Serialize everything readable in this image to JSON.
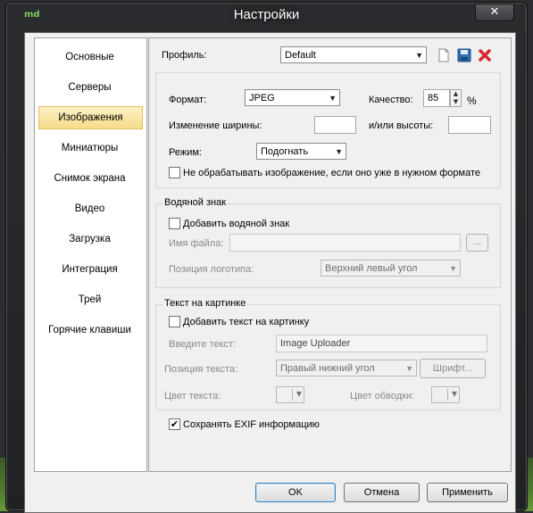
{
  "window": {
    "title": "Настройки",
    "app_icon_text": "md",
    "close_glyph": "✕"
  },
  "sidebar": {
    "items": [
      {
        "label": "Основные"
      },
      {
        "label": "Серверы"
      },
      {
        "label": "Изображения",
        "active": true
      },
      {
        "label": "Миниатюры"
      },
      {
        "label": "Снимок экрана"
      },
      {
        "label": "Видео"
      },
      {
        "label": "Загрузка"
      },
      {
        "label": "Интеграция"
      },
      {
        "label": "Трей"
      },
      {
        "label": "Горячие клавиши"
      }
    ]
  },
  "profile": {
    "label": "Профиль:",
    "value": "Default",
    "icons": [
      "new-file-icon",
      "save-icon",
      "delete-icon"
    ]
  },
  "image": {
    "format_label": "Формат:",
    "format_value": "JPEG",
    "quality_label": "Качество:",
    "quality_value": "85",
    "quality_unit": "%",
    "width_label": "Изменение ширины:",
    "width_value": "",
    "height_label": "и/или высоты:",
    "height_value": "",
    "mode_label": "Режим:",
    "mode_value": "Подогнать",
    "skip_checkbox_label": "Не обрабатывать изображение, если оно уже в нужном формате",
    "skip_checked": false
  },
  "watermark": {
    "group_title": "Водяной знак",
    "add_label": "Добавить водяной знак",
    "add_checked": false,
    "file_label": "Имя файла:",
    "file_value": "",
    "browse_label": "...",
    "position_label": "Позиция логотипа:",
    "position_value": "Верхний левый угол"
  },
  "text_overlay": {
    "group_title": "Текст на картинке",
    "add_label": "Добавить текст на картинку",
    "add_checked": false,
    "text_label": "Введите текст:",
    "text_value": "Image Uploader",
    "position_label": "Позиция текста:",
    "position_value": "Правый нижний угол",
    "font_button": "Шрифт...",
    "color_label": "Цвет текста:",
    "stroke_label": "Цвет обводки:"
  },
  "exif": {
    "label": "Сохранять EXIF информацию",
    "checked": true,
    "check_glyph": "✔"
  },
  "buttons": {
    "ok": "OK",
    "cancel": "Отмена",
    "apply": "Применить"
  },
  "glyphs": {
    "combo_arrow": "▼",
    "spin_up": "▲",
    "spin_down": "▼"
  }
}
